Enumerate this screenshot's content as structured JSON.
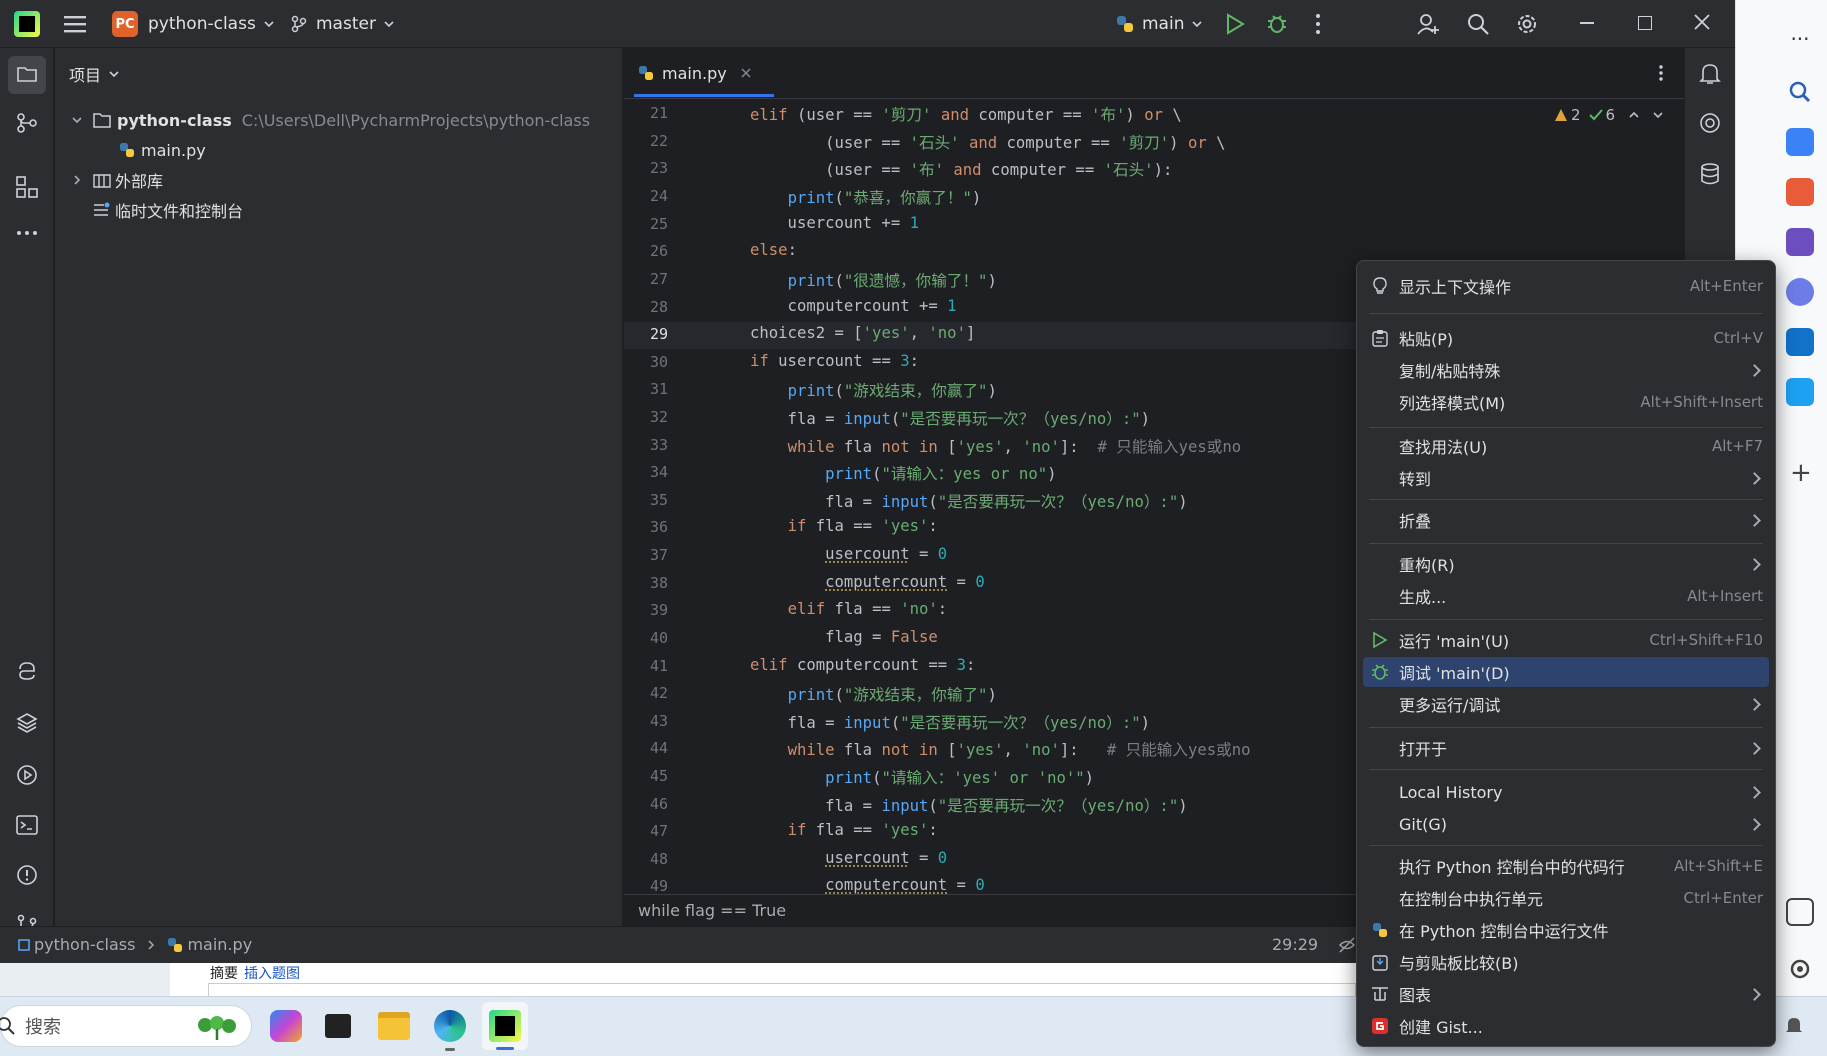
{
  "titlebar": {
    "project_name": "python-class",
    "project_badge": "PC",
    "branch": "master",
    "run_config": "main"
  },
  "project_panel": {
    "header": "项目",
    "root_name": "python-class",
    "root_path": "C:\\Users\\Dell\\PycharmProjects\\python-class",
    "file_main": "main.py",
    "external_libs": "外部库",
    "scratches": "临时文件和控制台"
  },
  "editor": {
    "tab_label": "main.py",
    "warnings": "2",
    "checks": "6",
    "breadcrumb": "while flag == True",
    "current_line": "29",
    "line_numbers": [
      "21",
      "22",
      "23",
      "24",
      "25",
      "26",
      "27",
      "28",
      "29",
      "30",
      "31",
      "32",
      "33",
      "34",
      "35",
      "36",
      "37",
      "38",
      "39",
      "40",
      "41",
      "42",
      "43",
      "44",
      "45",
      "46",
      "47",
      "48",
      "49"
    ]
  },
  "statusbar": {
    "project": "python-class",
    "file": "main.py",
    "position": "29:29"
  },
  "background_doc": {
    "summary": "摘要",
    "insert_link": "插入题图"
  },
  "taskbar": {
    "search_placeholder": "搜索"
  },
  "context_menu": {
    "items": [
      {
        "label": "显示上下文操作",
        "shortcut": "Alt+Enter"
      },
      {
        "label": "粘贴(P)",
        "shortcut": "Ctrl+V"
      },
      {
        "label": "复制/粘贴特殊",
        "shortcut": ""
      },
      {
        "label": "列选择模式(M)",
        "shortcut": "Alt+Shift+Insert"
      },
      {
        "label": "查找用法(U)",
        "shortcut": "Alt+F7"
      },
      {
        "label": "转到",
        "shortcut": ""
      },
      {
        "label": "折叠",
        "shortcut": ""
      },
      {
        "label": "重构(R)",
        "shortcut": ""
      },
      {
        "label": "生成...",
        "shortcut": "Alt+Insert"
      },
      {
        "label": "运行 'main'(U)",
        "shortcut": "Ctrl+Shift+F10"
      },
      {
        "label": "调试 'main'(D)",
        "shortcut": ""
      },
      {
        "label": "更多运行/调试",
        "shortcut": ""
      },
      {
        "label": "打开于",
        "shortcut": ""
      },
      {
        "label": "Local History",
        "shortcut": ""
      },
      {
        "label": "Git(G)",
        "shortcut": ""
      },
      {
        "label": "执行 Python 控制台中的代码行",
        "shortcut": "Alt+Shift+E"
      },
      {
        "label": "在控制台中执行单元",
        "shortcut": "Ctrl+Enter"
      },
      {
        "label": "在 Python 控制台中运行文件",
        "shortcut": ""
      },
      {
        "label": "与剪贴板比较(B)",
        "shortcut": ""
      },
      {
        "label": "图表",
        "shortcut": ""
      },
      {
        "label": "创建 Gist...",
        "shortcut": ""
      }
    ]
  },
  "colors": {
    "accent_selection": "#2e436e",
    "run_green": "#5fb865",
    "badge_orange": "#e0622b"
  }
}
